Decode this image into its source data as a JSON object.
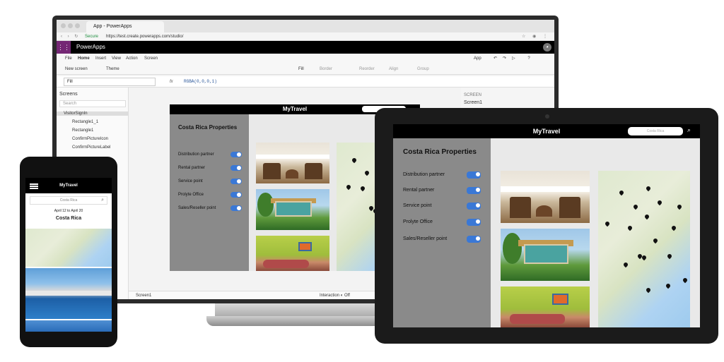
{
  "browser": {
    "tab_title": "App - PowerApps",
    "secure_label": "Secure",
    "url": "https://test.create.powerapps.com/studio/"
  },
  "studio": {
    "product_name": "PowerApps",
    "menu": [
      "File",
      "Home",
      "Insert",
      "View",
      "Action",
      "Screen"
    ],
    "menu_right": "App",
    "toolbar": [
      "New screen",
      "Theme",
      "Fill",
      "Border",
      "Reorder",
      "Align",
      "Group"
    ],
    "property": "Fill",
    "formula": "RGBA(0,0,0,1)",
    "tree_header": "Screens",
    "tree_search": "Search",
    "tree_items": [
      "VisitorSignIn",
      "Rectangle1_1",
      "Rectangle1",
      "ConfirmPictureIcon",
      "ConfirmPictureLabel"
    ],
    "right_panel_label": "SCREEN",
    "right_panel_value": "Screen1",
    "status_screen": "Screen1",
    "status_interaction": "Interaction",
    "status_off": "Off"
  },
  "app": {
    "title": "MyTravel",
    "heading": "Costa Rica Properties",
    "search_placeholder": "Costa Rica",
    "options": [
      "Distribution partner",
      "Rental partner",
      "Service point",
      "Prolyte Office",
      "Sales/Reseller point"
    ]
  },
  "phone": {
    "title": "MyTravel",
    "search_value": "Costa Rica",
    "dates": "April 12 to April 20",
    "place": "Costa Rica"
  },
  "colors": {
    "toggle_on": "#3a78d6",
    "powerapps_purple": "#742774",
    "app_bar": "#000000",
    "side_panel": "#8a8a8a"
  }
}
